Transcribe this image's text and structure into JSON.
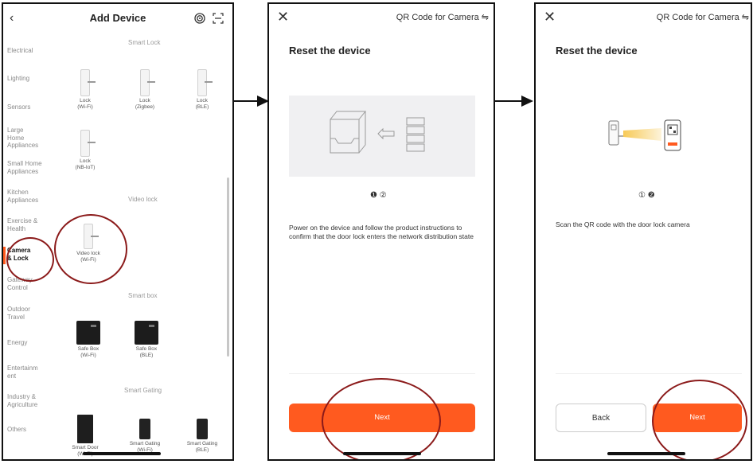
{
  "screen1": {
    "title": "Add Device",
    "categories": [
      {
        "label": "Electrical",
        "active": false
      },
      {
        "label": "Lighting",
        "active": false
      },
      {
        "label": "Sensors",
        "active": false
      },
      {
        "label": "Large Home Appliances",
        "active": false
      },
      {
        "label": "Small Home Appliances",
        "active": false
      },
      {
        "label": "Kitchen Appliances",
        "active": false
      },
      {
        "label": "Exercise & Health",
        "active": false
      },
      {
        "label": "Camera & Lock",
        "active": true
      },
      {
        "label": "Gateway Control",
        "active": false
      },
      {
        "label": "Outdoor Travel",
        "active": false
      },
      {
        "label": "Energy",
        "active": false
      },
      {
        "label": "Entertainm ent",
        "active": false
      },
      {
        "label": "Industry & Agriculture",
        "active": false
      },
      {
        "label": "Others",
        "active": false
      }
    ],
    "sections": {
      "smart_lock": "Smart Lock",
      "video_lock": "Video lock",
      "smart_box": "Smart box",
      "smart_gating": "Smart Gating"
    },
    "devices": {
      "lock_wifi": [
        "Lock",
        "(Wi-Fi)"
      ],
      "lock_zigbee": [
        "Lock",
        "(Zigbee)"
      ],
      "lock_ble": [
        "Lock",
        "(BLE)"
      ],
      "lock_nbiot": [
        "Lock",
        "(NB-IoT)"
      ],
      "video_lock_wifi": [
        "Video lock",
        "(Wi-Fi)"
      ],
      "safe_box_wifi": [
        "Safe Box",
        "(Wi-Fi)"
      ],
      "safe_box_ble": [
        "Safe Box",
        "(BLE)"
      ],
      "smart_door_wifi": [
        "Smart Door",
        "(Wi-Fi)"
      ],
      "smart_gating_wifi": [
        "Smart Gating",
        "(Wi-Fi)"
      ],
      "smart_gating_ble": [
        "Smart Gating",
        "(BLE)"
      ]
    }
  },
  "screen2": {
    "header_title": "QR Code for Camera ⇋",
    "title": "Reset the device",
    "step_indicator": "❶ ②",
    "description": "Power on the device and follow the product instructions to confirm that the door lock enters the network distribution state",
    "next_label": "Next"
  },
  "screen3": {
    "header_title": "QR Code for Camera ⇋",
    "title": "Reset the device",
    "step_indicator": "① ❷",
    "description": "Scan the QR code with the door lock camera",
    "back_label": "Back",
    "next_label": "Next"
  },
  "colors": {
    "accent": "#ff5a1f",
    "annotation": "#8b1a1a"
  }
}
